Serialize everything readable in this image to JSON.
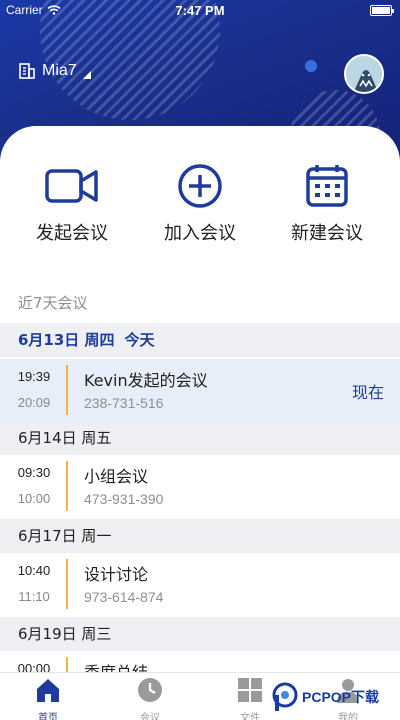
{
  "status": {
    "carrier": "Carrier",
    "time": "7:47 PM"
  },
  "header": {
    "user_name": "Mia7"
  },
  "actions": [
    {
      "label": "发起会议",
      "icon": "video-camera-icon"
    },
    {
      "label": "加入会议",
      "icon": "plus-circle-icon"
    },
    {
      "label": "新建会议",
      "icon": "calendar-icon"
    }
  ],
  "recent_title": "近7天会议",
  "days": [
    {
      "date": "6月13日 周四",
      "today_label": "今天",
      "meetings": [
        {
          "start": "19:39",
          "end": "20:09",
          "title": "Kevin发起的会议",
          "id": "238-731-516",
          "status": "现在"
        }
      ]
    },
    {
      "date": "6月14日 周五",
      "meetings": [
        {
          "start": "09:30",
          "end": "10:00",
          "title": "小组会议",
          "id": "473-931-390"
        }
      ]
    },
    {
      "date": "6月17日 周一",
      "meetings": [
        {
          "start": "10:40",
          "end": "11:10",
          "title": "设计讨论",
          "id": "973-614-874"
        }
      ]
    },
    {
      "date": "6月19日 周三",
      "meetings": [
        {
          "start": "00:00",
          "title": "季度总结"
        }
      ]
    }
  ],
  "tabs": [
    {
      "label": "首页",
      "icon": "home-icon"
    },
    {
      "label": "会议",
      "icon": "clock-icon"
    },
    {
      "label": "文件",
      "icon": "grid-icon"
    },
    {
      "label": "我的",
      "icon": "person-icon"
    }
  ],
  "watermark": "PCPOP下载",
  "colors": {
    "primary": "#1f3b9c",
    "accent": "#f2b44a",
    "header_bg": "#1a2f8c"
  }
}
